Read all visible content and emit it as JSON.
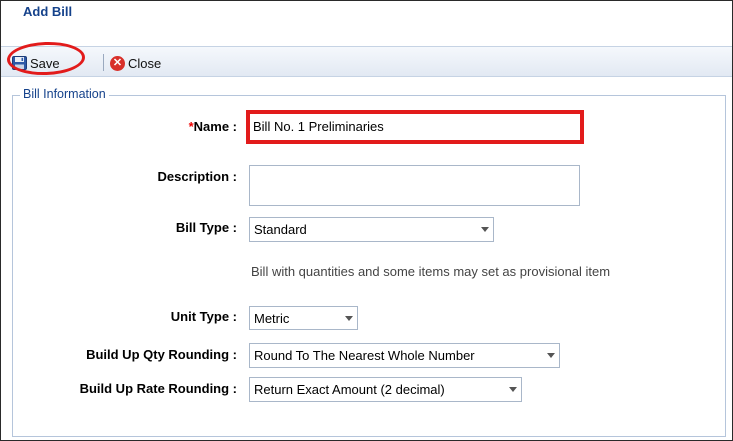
{
  "dialog": {
    "title": "Add Bill"
  },
  "toolbar": {
    "save_label": "Save",
    "close_label": "Close"
  },
  "icons": {
    "save": "floppy-disk-icon",
    "close": "close-circle-icon",
    "dropdown": "chevron-down-icon"
  },
  "colors": {
    "annotation": "#e21b1b",
    "title": "#15428b",
    "required": "#e00000"
  },
  "section": {
    "legend": "Bill Information"
  },
  "form": {
    "name": {
      "required_mark": "*",
      "label": "Name :",
      "value": "Bill No. 1 Preliminaries"
    },
    "description": {
      "label": "Description :",
      "value": ""
    },
    "bill_type": {
      "label": "Bill Type :",
      "value": "Standard",
      "hint": "Bill with quantities and some items may set as provisional item"
    },
    "unit_type": {
      "label": "Unit Type :",
      "value": "Metric"
    },
    "qty_rounding": {
      "label": "Build Up Qty Rounding :",
      "value": "Round To The Nearest Whole Number"
    },
    "rate_rounding": {
      "label": "Build Up Rate Rounding :",
      "value": "Return Exact Amount (2 decimal)"
    }
  }
}
